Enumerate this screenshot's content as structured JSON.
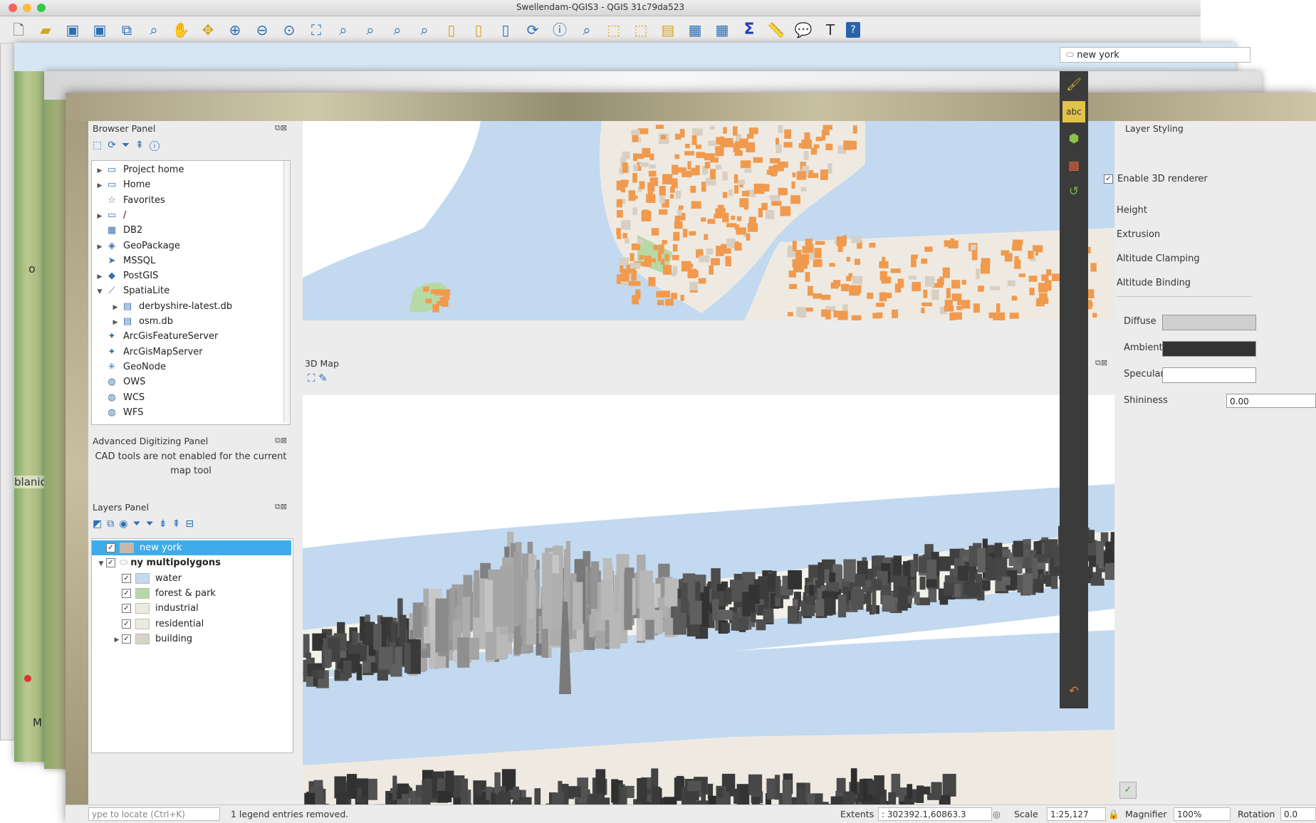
{
  "window": {
    "title": "Swellendam-QGIS3 - QGIS 31c79da523"
  },
  "colors": {
    "accent": "#3eacea",
    "water": "#c2d9f0",
    "building": "#f19a4e",
    "park": "#b7d9a5"
  },
  "toolbar": {
    "icons": [
      "new-project-icon",
      "open-project-icon",
      "save-project-icon",
      "save-as-icon",
      "new-print-layout-icon",
      "layout-manager-icon",
      "pan-icon",
      "pan-to-selection-icon",
      "zoom-in-icon",
      "zoom-out-icon",
      "zoom-native-icon",
      "zoom-full-icon",
      "zoom-to-selection-icon",
      "zoom-to-layer-icon",
      "zoom-last-icon",
      "zoom-next-icon",
      "new-map-view-icon",
      "new-3d-map-view-icon",
      "new-bookmark-icon",
      "refresh-icon",
      "identify-icon",
      "measure-icon",
      "select-icon",
      "deselect-icon",
      "attribute-table-icon",
      "field-calculator-icon",
      "statistics-icon",
      "measure-line-icon",
      "map-tips-icon",
      "text-annotation-icon",
      "help-icon"
    ]
  },
  "background": {
    "label_o": "o",
    "label_blanic": "blanic",
    "label_m": "M"
  },
  "browser": {
    "title": "Browser Panel",
    "items": [
      {
        "label": "Project home",
        "expander": "▶",
        "icon": "folder-icon",
        "glyph": "▭",
        "indent": 0
      },
      {
        "label": "Home",
        "expander": "▶",
        "icon": "folder-icon",
        "glyph": "▭",
        "indent": 0
      },
      {
        "label": "Favorites",
        "expander": "",
        "icon": "star-icon",
        "glyph": "☆",
        "indent": 0
      },
      {
        "label": "/",
        "expander": "▶",
        "icon": "folder-icon",
        "glyph": "▭",
        "indent": 0
      },
      {
        "label": "DB2",
        "expander": "",
        "icon": "db2-icon",
        "glyph": "▦",
        "indent": 0
      },
      {
        "label": "GeoPackage",
        "expander": "▶",
        "icon": "geopackage-icon",
        "glyph": "◈",
        "indent": 0
      },
      {
        "label": "MSSQL",
        "expander": "",
        "icon": "mssql-icon",
        "glyph": "➤",
        "indent": 0
      },
      {
        "label": "PostGIS",
        "expander": "▶",
        "icon": "postgis-icon",
        "glyph": "◆",
        "indent": 0
      },
      {
        "label": "SpatiaLite",
        "expander": "▼",
        "icon": "spatialite-icon",
        "glyph": "⟋",
        "indent": 0
      },
      {
        "label": "derbyshire-latest.db",
        "expander": "▶",
        "icon": "database-icon",
        "glyph": "▤",
        "indent": 1
      },
      {
        "label": "osm.db",
        "expander": "▶",
        "icon": "database-icon",
        "glyph": "▤",
        "indent": 1
      },
      {
        "label": "ArcGisFeatureServer",
        "expander": "",
        "icon": "arcgis-icon",
        "glyph": "✦",
        "indent": 0
      },
      {
        "label": "ArcGisMapServer",
        "expander": "",
        "icon": "arcgis-icon",
        "glyph": "✦",
        "indent": 0
      },
      {
        "label": "GeoNode",
        "expander": "",
        "icon": "geonode-icon",
        "glyph": "✳",
        "indent": 0
      },
      {
        "label": "OWS",
        "expander": "",
        "icon": "globe-icon",
        "glyph": "◍",
        "indent": 0
      },
      {
        "label": "WCS",
        "expander": "",
        "icon": "globe-icon",
        "glyph": "◍",
        "indent": 0
      },
      {
        "label": "WFS",
        "expander": "",
        "icon": "globe-icon",
        "glyph": "◍",
        "indent": 0
      }
    ]
  },
  "adp": {
    "title": "Advanced Digitizing Panel",
    "line1": "CAD tools are not enabled for the current",
    "line2": "map tool"
  },
  "layers": {
    "title": "Layers Panel",
    "items": [
      {
        "label": "new york",
        "expander": "",
        "indent": 0,
        "checked": true,
        "selected": true,
        "bold": false,
        "swatch": "#c9b7a6"
      },
      {
        "label": "ny multipolygons",
        "expander": "▼",
        "indent": 0,
        "checked": true,
        "selected": false,
        "bold": true,
        "swatch": ""
      },
      {
        "label": "water",
        "expander": "",
        "indent": 1,
        "checked": true,
        "selected": false,
        "bold": false,
        "swatch": "#c2d9f0"
      },
      {
        "label": "forest & park",
        "expander": "",
        "indent": 1,
        "checked": true,
        "selected": false,
        "bold": false,
        "swatch": "#b7d9a5"
      },
      {
        "label": "industrial",
        "expander": "",
        "indent": 1,
        "checked": true,
        "selected": false,
        "bold": false,
        "swatch": "#eeeae2"
      },
      {
        "label": "residential",
        "expander": "",
        "indent": 1,
        "checked": true,
        "selected": false,
        "bold": false,
        "swatch": "#eeeae2"
      },
      {
        "label": "building",
        "expander": "▶",
        "indent": 1,
        "checked": true,
        "selected": false,
        "bold": false,
        "swatch": "#d9d4c8"
      }
    ]
  },
  "map3d": {
    "title": "3D Map"
  },
  "styling": {
    "title": "Layer Styling",
    "layer": "new york",
    "enable_3d": "Enable 3D renderer",
    "height": "Height",
    "extrusion": "Extrusion",
    "altitude_clamping": "Altitude Clamping",
    "altitude_binding": "Altitude Binding",
    "diffuse": "Diffuse",
    "ambient": "Ambient",
    "specular": "Specular",
    "shininess": "Shininess",
    "shininess_value": "0.00",
    "colors": {
      "diffuse": "#cfcfcf",
      "ambient": "#333333",
      "specular": "#ffffff"
    }
  },
  "status": {
    "locator_placeholder": "ype to locate (Ctrl+K)",
    "message": "1 legend entries removed.",
    "extents_label": "Extents",
    "extents_value": ": 302392.1,60863.3",
    "scale_label": "Scale",
    "scale_value": "1:25,127",
    "magnifier_label": "Magnifier",
    "magnifier_value": "100%",
    "rotation_label": "Rotation",
    "rotation_value": "0.0"
  }
}
